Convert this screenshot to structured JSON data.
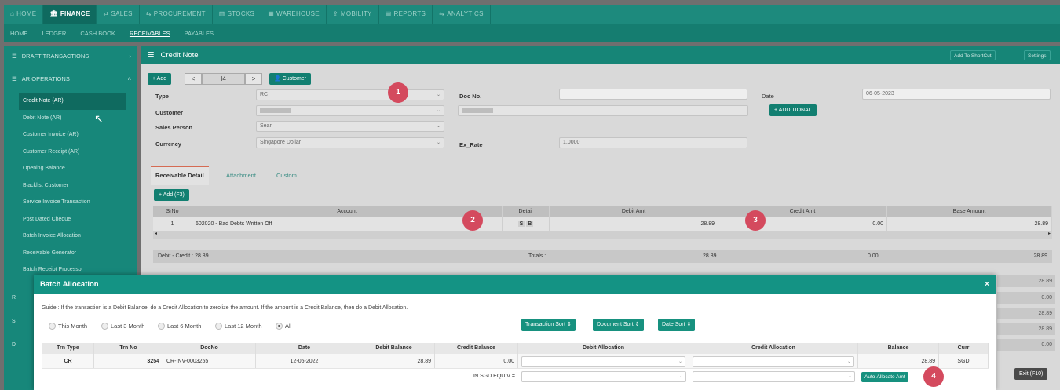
{
  "top_tabs": [
    {
      "icon": "⌂",
      "label": "HOME"
    },
    {
      "icon": "🏛",
      "label": "FINANCE"
    },
    {
      "icon": "⇄",
      "label": "SALES"
    },
    {
      "icon": "⇆",
      "label": "PROCUREMENT"
    },
    {
      "icon": "▥",
      "label": "STOCKS"
    },
    {
      "icon": "▦",
      "label": "WAREHOUSE"
    },
    {
      "icon": "⇪",
      "label": "MOBILITY"
    },
    {
      "icon": "▤",
      "label": "REPORTS"
    },
    {
      "icon": "⇋",
      "label": "ANALYTICS"
    }
  ],
  "sub_tabs": [
    "HOME",
    "LEDGER",
    "CASH BOOK",
    "RECEIVABLES",
    "PAYABLES"
  ],
  "sidebar": {
    "draft": "DRAFT TRANSACTIONS",
    "ar_ops": "AR OPERATIONS",
    "items": [
      "Credit Note (AR)",
      "Debit Note (AR)",
      "Customer Invoice (AR)",
      "Customer Receipt (AR)",
      "Opening Balance",
      "Blacklist Customer",
      "Service Invoice Transaction",
      "Post Dated Cheque",
      "Batch Invoice Allocation",
      "Receivable Generator",
      "Batch Receipt Processor"
    ],
    "mini": [
      "R",
      "S",
      "D"
    ]
  },
  "main": {
    "title": "Credit Note",
    "add_shortcut": "Add To ShortCut",
    "settings": "Settings",
    "add": "+ Add",
    "prev": "<",
    "page": "I4",
    "next": ">",
    "customer_btn": "Customer",
    "labels": {
      "type": "Type",
      "customer": "Customer",
      "sales_person": "Sales Person",
      "currency": "Currency",
      "doc_no": "Doc No.",
      "ex_rate": "Ex_Rate",
      "date": "Date"
    },
    "values": {
      "type": "RC",
      "sales_person": "Sean",
      "currency": "Singapore Dollar",
      "ex_rate": "1.0000",
      "date": "06-05-2023"
    },
    "additional": "+ ADDITIONAL",
    "tabs": [
      "Receivable Detail",
      "Attachment",
      "Custom"
    ],
    "add_f3": "+ Add (F3)",
    "grid_head": [
      "SrNo",
      "Account",
      "Detail",
      "Debit Amt",
      "Credit Amt",
      "Base Amount"
    ],
    "grid_row": {
      "srno": "1",
      "account": "602020 - Bad Debts Written Off",
      "detail_s": "S",
      "detail_b": "B",
      "debit": "28.89",
      "credit": "0.00",
      "base": "28.89"
    },
    "debit_credit": "Debit - Credit : 28.89",
    "totals_label": "Totals :",
    "total_debit": "28.89",
    "total_credit": "0.00",
    "total_base": "28.89",
    "right_vals": [
      "28.89",
      "0.00",
      "28.89",
      "28.89",
      "0.00"
    ],
    "exit": "Exit (F10)"
  },
  "badges": [
    "1",
    "2",
    "3",
    "4"
  ],
  "modal": {
    "title": "Batch Allocation",
    "close": "×",
    "guide": "Guide : If the transaction is a Debit Balance, do a Credit Allocation to zerolize the amount. If the amount is a Credit Balance, then do a Debit Allocation.",
    "periods": [
      "This Month",
      "Last 3 Month",
      "Last 6 Month",
      "Last 12 Month",
      "All"
    ],
    "selected_period": "All",
    "sorts": [
      "Transaction Sort ⇕",
      "Document Sort ⇕",
      "Date Sort ⇕"
    ],
    "headers": [
      "Trn Type",
      "Trn No",
      "DocNo",
      "Date",
      "Debit Balance",
      "Credit Balance",
      "Debit Allocation",
      "Credit Allocation",
      "Balance",
      "Curr"
    ],
    "row": {
      "type": "CR",
      "no": "3254",
      "doc": "CR-INV-0003255",
      "date": "12-05-2022",
      "debit": "28.89",
      "credit": "0.00",
      "balance": "28.89",
      "curr": "SGD"
    },
    "equiv": "IN SGD EQUIV =",
    "auto_allocate": "Auto-Allocate Amt"
  }
}
